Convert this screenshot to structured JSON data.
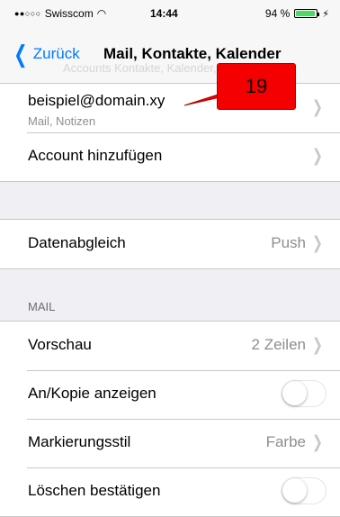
{
  "status": {
    "carrier": "Swisscom",
    "signal_dots": "●●○○○",
    "time": "14:44",
    "battery": "94 %",
    "battery_level": 0.94,
    "wifi_icon": "wifi-icon",
    "charging_icon": "bolt-icon"
  },
  "nav": {
    "back_label": "Zurück",
    "title": "Mail, Kontakte, Kalender",
    "ghost_text": "Accounts Kontakte, Kalender, Notizen"
  },
  "account": {
    "email": "beispiel@domain.xy",
    "services": "Mail, Notizen",
    "add_label": "Account hinzufügen"
  },
  "fetch": {
    "label": "Datenabgleich",
    "value": "Push"
  },
  "mail_section": {
    "header": "MAIL",
    "preview_label": "Vorschau",
    "preview_value": "2 Zeilen",
    "cc_label": "An/Kopie anzeigen",
    "cc_on": false,
    "flag_label": "Markierungsstil",
    "flag_value": "Farbe",
    "delete_label": "Löschen bestätigen",
    "delete_on": false
  },
  "annotation": {
    "number": "19",
    "color": "#f50000"
  },
  "colors": {
    "accent": "#007aff",
    "background": "#efeff4",
    "separator": "#c8c7cc"
  }
}
